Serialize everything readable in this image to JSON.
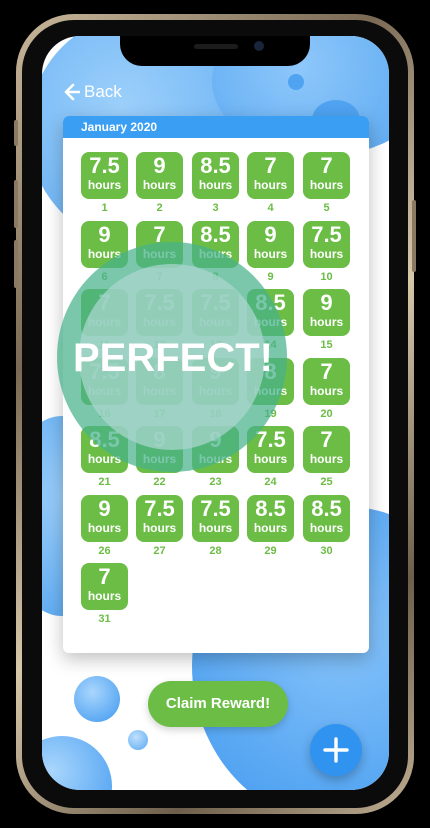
{
  "nav": {
    "back_label": "Back"
  },
  "calendar": {
    "month_label": "January 2020",
    "unit": "hours",
    "days": [
      {
        "day": "1",
        "hours": "7.5"
      },
      {
        "day": "2",
        "hours": "9"
      },
      {
        "day": "3",
        "hours": "8.5"
      },
      {
        "day": "4",
        "hours": "7"
      },
      {
        "day": "5",
        "hours": "7"
      },
      {
        "day": "6",
        "hours": "9"
      },
      {
        "day": "7",
        "hours": "7"
      },
      {
        "day": "8",
        "hours": "8.5"
      },
      {
        "day": "9",
        "hours": "9"
      },
      {
        "day": "10",
        "hours": "7.5"
      },
      {
        "day": "11",
        "hours": "7"
      },
      {
        "day": "12",
        "hours": "7.5"
      },
      {
        "day": "13",
        "hours": "7.5"
      },
      {
        "day": "14",
        "hours": "8.5"
      },
      {
        "day": "15",
        "hours": "9"
      },
      {
        "day": "16",
        "hours": "7.5"
      },
      {
        "day": "17",
        "hours": "8"
      },
      {
        "day": "18",
        "hours": "9"
      },
      {
        "day": "19",
        "hours": "8"
      },
      {
        "day": "20",
        "hours": "7"
      },
      {
        "day": "21",
        "hours": "8.5"
      },
      {
        "day": "22",
        "hours": "9"
      },
      {
        "day": "23",
        "hours": "9"
      },
      {
        "day": "24",
        "hours": "7.5"
      },
      {
        "day": "25",
        "hours": "7"
      },
      {
        "day": "26",
        "hours": "9"
      },
      {
        "day": "27",
        "hours": "7.5"
      },
      {
        "day": "28",
        "hours": "7.5"
      },
      {
        "day": "29",
        "hours": "8.5"
      },
      {
        "day": "30",
        "hours": "8.5"
      },
      {
        "day": "31",
        "hours": "7"
      }
    ]
  },
  "overlay": {
    "text": "PERFECT!"
  },
  "actions": {
    "claim_label": "Claim Reward!",
    "add_icon": "plus-icon"
  },
  "colors": {
    "accent_blue": "#3a9ef3",
    "tile_green": "#6bbd45",
    "overlay_teal": "#48b28c"
  }
}
